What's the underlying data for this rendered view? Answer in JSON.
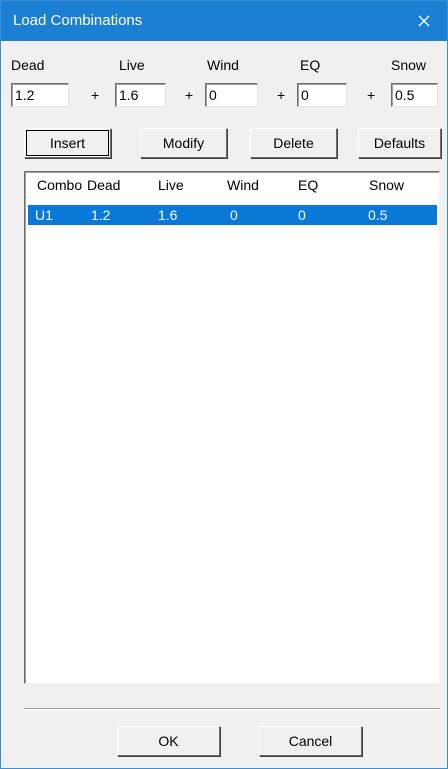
{
  "window": {
    "title": "Load Combinations"
  },
  "inputs": {
    "dead": {
      "label": "Dead",
      "value": "1.2"
    },
    "live": {
      "label": "Live",
      "value": "1.6"
    },
    "wind": {
      "label": "Wind",
      "value": "0"
    },
    "eq": {
      "label": "EQ",
      "value": "0"
    },
    "snow": {
      "label": "Snow",
      "value": "0.5"
    },
    "plus": "+"
  },
  "buttons": {
    "insert": "Insert",
    "modify": "Modify",
    "delete": "Delete",
    "defaults": "Defaults",
    "ok": "OK",
    "cancel": "Cancel"
  },
  "list": {
    "columns": [
      "Combo",
      "Dead",
      "Live",
      "Wind",
      "EQ",
      "Snow"
    ],
    "rows": [
      {
        "combo": "U1",
        "dead": "1.2",
        "live": "1.6",
        "wind": "0",
        "eq": "0",
        "snow": "0.5",
        "selected": true
      }
    ]
  },
  "colors": {
    "titlebar": "#1b7fd4",
    "selection": "#0a78d7",
    "face": "#f0f0f0"
  },
  "icons": {
    "close": "close-icon"
  }
}
